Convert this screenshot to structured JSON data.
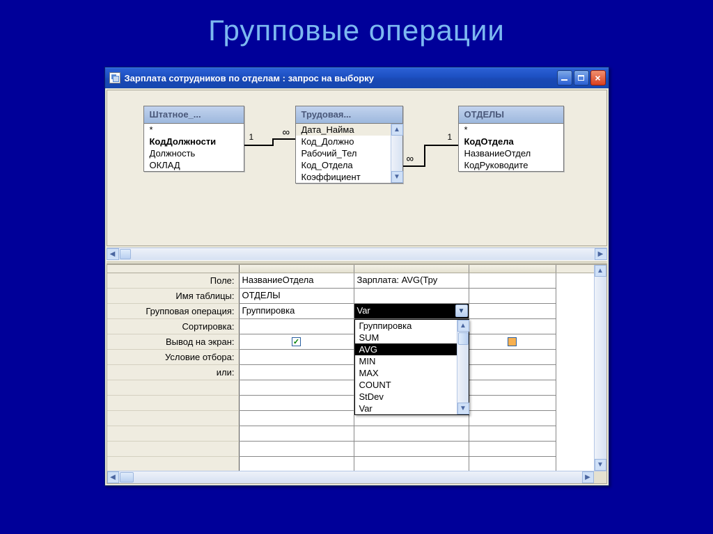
{
  "slide": {
    "title": "Групповые операции"
  },
  "window": {
    "title": "Зарплата сотрудников по отделам : запрос на выборку"
  },
  "tables": {
    "t1": {
      "title": "Штатное_...",
      "fields": [
        "*",
        "КодДолжности",
        "Должность",
        "ОКЛАД"
      ],
      "bold": [
        1
      ]
    },
    "t2": {
      "title": "Трудовая...",
      "fields": [
        "Дата_Найма",
        "Код_Должно",
        "Рабочий_Тел",
        "Код_Отдела",
        "Коэффициент"
      ]
    },
    "t3": {
      "title": "ОТДЕЛЫ",
      "fields": [
        "*",
        "КодОтдела",
        "НазваниеОтдел",
        "КодРуководите"
      ],
      "bold": [
        1
      ]
    }
  },
  "relations": {
    "r1": {
      "left": "1",
      "right": "∞"
    },
    "r2": {
      "left": "∞",
      "right": "1"
    }
  },
  "grid": {
    "labels": [
      "Поле:",
      "Имя таблицы:",
      "Групповая операция:",
      "Сортировка:",
      "Вывод на экран:",
      "Условие отбора:",
      "или:"
    ],
    "col1": {
      "field": "НазваниеОтдела",
      "table": "ОТДЕЛЫ",
      "groupop": "Группировка",
      "sort": "",
      "show": true
    },
    "col2": {
      "field": "Зарплата: AVG(Тру",
      "table": "",
      "groupop": "Var",
      "sort": "",
      "show": false
    },
    "dropdown": {
      "options": [
        "Группировка",
        "SUM",
        "AVG",
        "MIN",
        "MAX",
        "COUNT",
        "StDev",
        "Var"
      ],
      "selected": "AVG"
    }
  }
}
